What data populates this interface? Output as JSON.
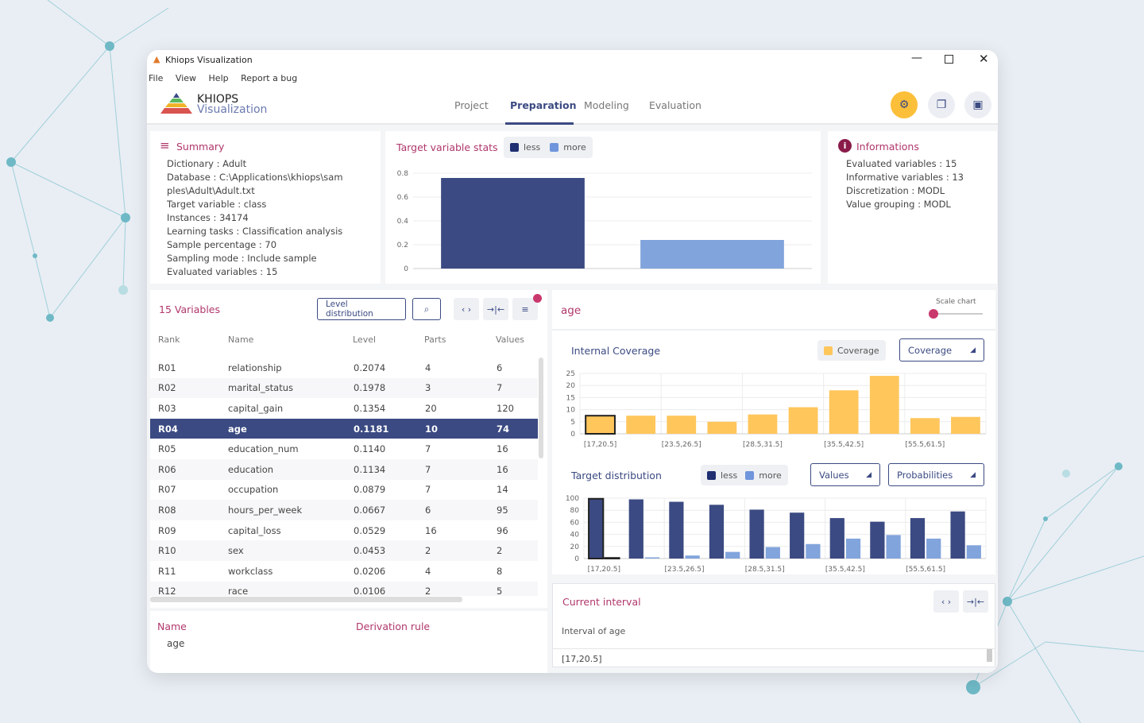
{
  "window": {
    "title": "Khiops Visualization",
    "menu": [
      "File",
      "View",
      "Help",
      "Report a bug"
    ]
  },
  "logo": {
    "line1": "KHIOPS",
    "line2": "Visualization"
  },
  "tabs": [
    {
      "label": "Project"
    },
    {
      "label": "Preparation",
      "active": true
    },
    {
      "label": "Modeling"
    },
    {
      "label": "Evaluation"
    }
  ],
  "colors": {
    "accent": "#3b4a82",
    "pink": "#b0376b",
    "less": "#3b4a82",
    "more": "#82a4dc",
    "coverage": "#ffc65c",
    "settings": "#fbbf3a"
  },
  "summary": {
    "title": "Summary",
    "lines": [
      "Dictionary : Adult",
      "Database : C:\\Applications\\khiops\\sam",
      "ples\\Adult\\Adult.txt",
      "Target variable : class",
      "Instances : 34174",
      "Learning tasks : Classification analysis",
      "Sample percentage : 70",
      "Sampling mode : Include sample",
      "Evaluated variables : 15"
    ]
  },
  "target_stats": {
    "title": "Target variable stats",
    "legend": [
      "less",
      "more"
    ]
  },
  "informations": {
    "title": "Informations",
    "lines": [
      "Evaluated variables : 15",
      "Informative variables : 13",
      "Discretization : MODL",
      "Value grouping : MODL"
    ]
  },
  "variables": {
    "title": "15 Variables",
    "level_button": "Level distribution",
    "columns": [
      "Rank",
      "Name",
      "Level",
      "Parts",
      "Values"
    ],
    "rows": [
      [
        "R01",
        "relationship",
        "0.2074",
        "4",
        "6"
      ],
      [
        "R02",
        "marital_status",
        "0.1978",
        "3",
        "7"
      ],
      [
        "R03",
        "capital_gain",
        "0.1354",
        "20",
        "120"
      ],
      [
        "R04",
        "age",
        "0.1181",
        "10",
        "74"
      ],
      [
        "R05",
        "education_num",
        "0.1140",
        "7",
        "16"
      ],
      [
        "R06",
        "education",
        "0.1134",
        "7",
        "16"
      ],
      [
        "R07",
        "occupation",
        "0.0879",
        "7",
        "14"
      ],
      [
        "R08",
        "hours_per_week",
        "0.0667",
        "6",
        "95"
      ],
      [
        "R09",
        "capital_loss",
        "0.0529",
        "16",
        "96"
      ],
      [
        "R10",
        "sex",
        "0.0453",
        "2",
        "2"
      ],
      [
        "R11",
        "workclass",
        "0.0206",
        "4",
        "8"
      ],
      [
        "R12",
        "race",
        "0.0106",
        "2",
        "5"
      ]
    ],
    "selected_index": 3
  },
  "derivation": {
    "name_label": "Name",
    "rule_label": "Derivation rule",
    "name_value": "age"
  },
  "detail": {
    "variable": "age",
    "scale_label": "Scale chart",
    "scale_value": 0,
    "coverage_title": "Internal Coverage",
    "coverage_legend": "Coverage",
    "coverage_select": "Coverage",
    "dist_title": "Target distribution",
    "dist_legend": [
      "less",
      "more"
    ],
    "values_select": "Values",
    "prob_select": "Probabilities"
  },
  "interval": {
    "title": "Current interval",
    "column": "Interval of age",
    "value": "[17,20.5]"
  },
  "chart_data": [
    {
      "type": "bar",
      "title": "Target variable stats",
      "categories": [
        "less",
        "more"
      ],
      "values": [
        0.76,
        0.24
      ],
      "ylim": [
        0,
        0.8
      ],
      "yticks": [
        0,
        0.2,
        0.4,
        0.6,
        0.8
      ],
      "grid": true,
      "legend": "top"
    },
    {
      "type": "bar",
      "title": "Internal Coverage",
      "categories": [
        "[17,20.5]",
        "",
        "[23.5,26.5]",
        "",
        "[28.5,31.5]",
        "",
        "[35.5,42.5]",
        "",
        "[55.5,61.5]",
        ""
      ],
      "values": [
        7.5,
        7.5,
        7.5,
        5,
        8,
        11,
        18,
        24,
        6.5,
        7
      ],
      "ylim": [
        0,
        25
      ],
      "yticks": [
        0,
        5,
        10,
        15,
        20,
        25
      ],
      "grid": true,
      "selected": 0
    },
    {
      "type": "bar",
      "title": "Target distribution",
      "categories": [
        "[17,20.5]",
        "",
        "[23.5,26.5]",
        "",
        "[28.5,31.5]",
        "",
        "[35.5,42.5]",
        "",
        "[55.5,61.5]",
        ""
      ],
      "series": [
        {
          "name": "less",
          "values": [
            99,
            98,
            94,
            89,
            81,
            76,
            67,
            61,
            67,
            78
          ]
        },
        {
          "name": "more",
          "values": [
            1,
            2,
            5,
            11,
            19,
            24,
            33,
            39,
            33,
            22
          ]
        }
      ],
      "ylim": [
        0,
        100
      ],
      "yticks": [
        0,
        20,
        40,
        60,
        80,
        100
      ],
      "grid": true,
      "selected": 0
    }
  ]
}
